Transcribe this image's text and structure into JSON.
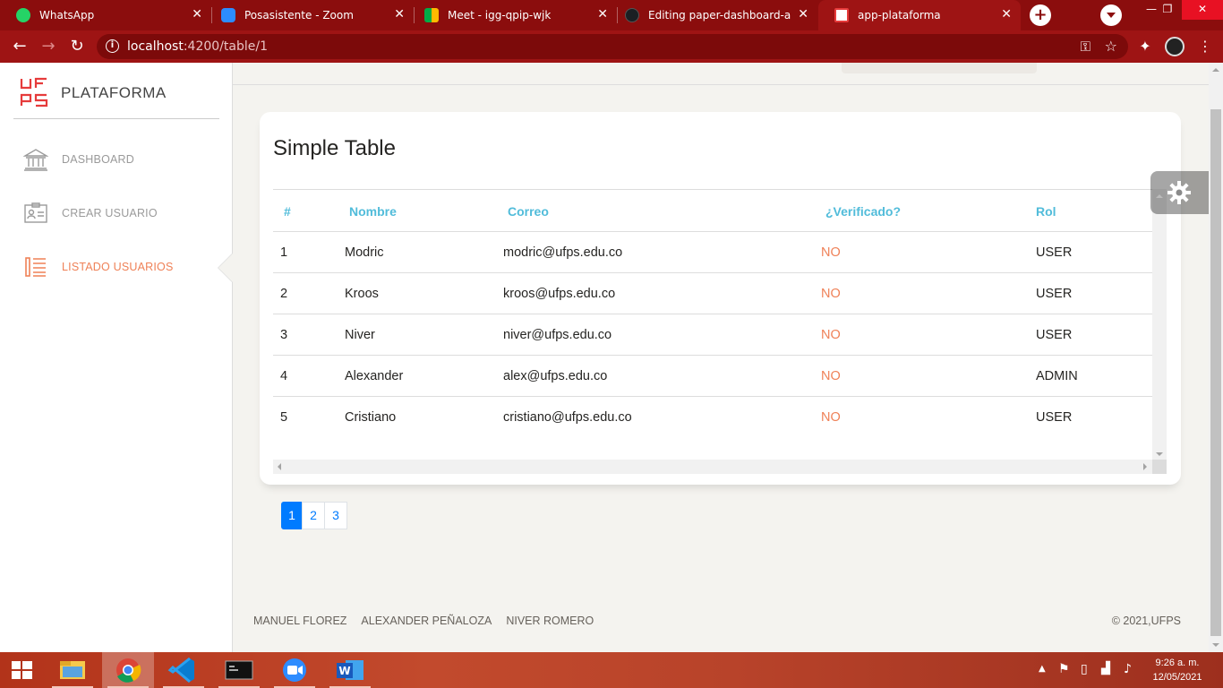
{
  "browser": {
    "tabs": [
      {
        "title": "WhatsApp",
        "icon": "whatsapp-icon",
        "color": "#25d366"
      },
      {
        "title": "Posasistente - Zoom",
        "icon": "zoom-icon",
        "color": "#2d8cff"
      },
      {
        "title": "Meet - igg-qpip-wjk",
        "icon": "meet-icon",
        "color": "#00ac47"
      },
      {
        "title": "Editing paper-dashboard-angu",
        "icon": "github-icon",
        "color": "#1b1f23"
      },
      {
        "title": "app-plataforma",
        "icon": "ufps-icon",
        "color": "#e63b3b"
      }
    ],
    "url_host": "localhost",
    "url_path": ":4200/table/1",
    "frame_color": "#8b0d0d"
  },
  "sidebar": {
    "brand": "PLATAFORMA",
    "items": [
      {
        "label": "DASHBOARD",
        "icon": "bank-icon",
        "active": false
      },
      {
        "label": "CREAR USUARIO",
        "icon": "id-card-icon",
        "active": false
      },
      {
        "label": "LISTADO USUARIOS",
        "icon": "list-icon",
        "active": true
      }
    ],
    "active_color": "#ef8157"
  },
  "card": {
    "title": "Simple Table",
    "headers": [
      "#",
      "Nombre",
      "Correo",
      "¿Verificado?",
      "Rol"
    ],
    "rows": [
      {
        "num": "1",
        "name": "Modric",
        "email": "modric@ufps.edu.co",
        "verified": "NO",
        "role": "USER"
      },
      {
        "num": "2",
        "name": "Kroos",
        "email": "kroos@ufps.edu.co",
        "verified": "NO",
        "role": "USER"
      },
      {
        "num": "3",
        "name": "Niver",
        "email": "niver@ufps.edu.co",
        "verified": "NO",
        "role": "USER"
      },
      {
        "num": "4",
        "name": "Alexander",
        "email": "alex@ufps.edu.co",
        "verified": "NO",
        "role": "ADMIN"
      },
      {
        "num": "5",
        "name": "Cristiano",
        "email": "cristiano@ufps.edu.co",
        "verified": "NO",
        "role": "USER"
      }
    ],
    "header_color": "#51bcda"
  },
  "pagination": {
    "pages": [
      "1",
      "2",
      "3"
    ],
    "current": "1"
  },
  "footer": {
    "links": [
      "MANUEL FLOREZ",
      "ALEXANDER PEÑALOZA",
      "NIVER ROMERO"
    ],
    "copyright": "© 2021,UFPS"
  },
  "taskbar": {
    "apps": [
      "file-explorer-icon",
      "chrome-icon",
      "vscode-icon",
      "terminal-icon",
      "zoom-icon",
      "word-icon"
    ],
    "time": "9:26 a. m.",
    "date": "12/05/2021"
  }
}
